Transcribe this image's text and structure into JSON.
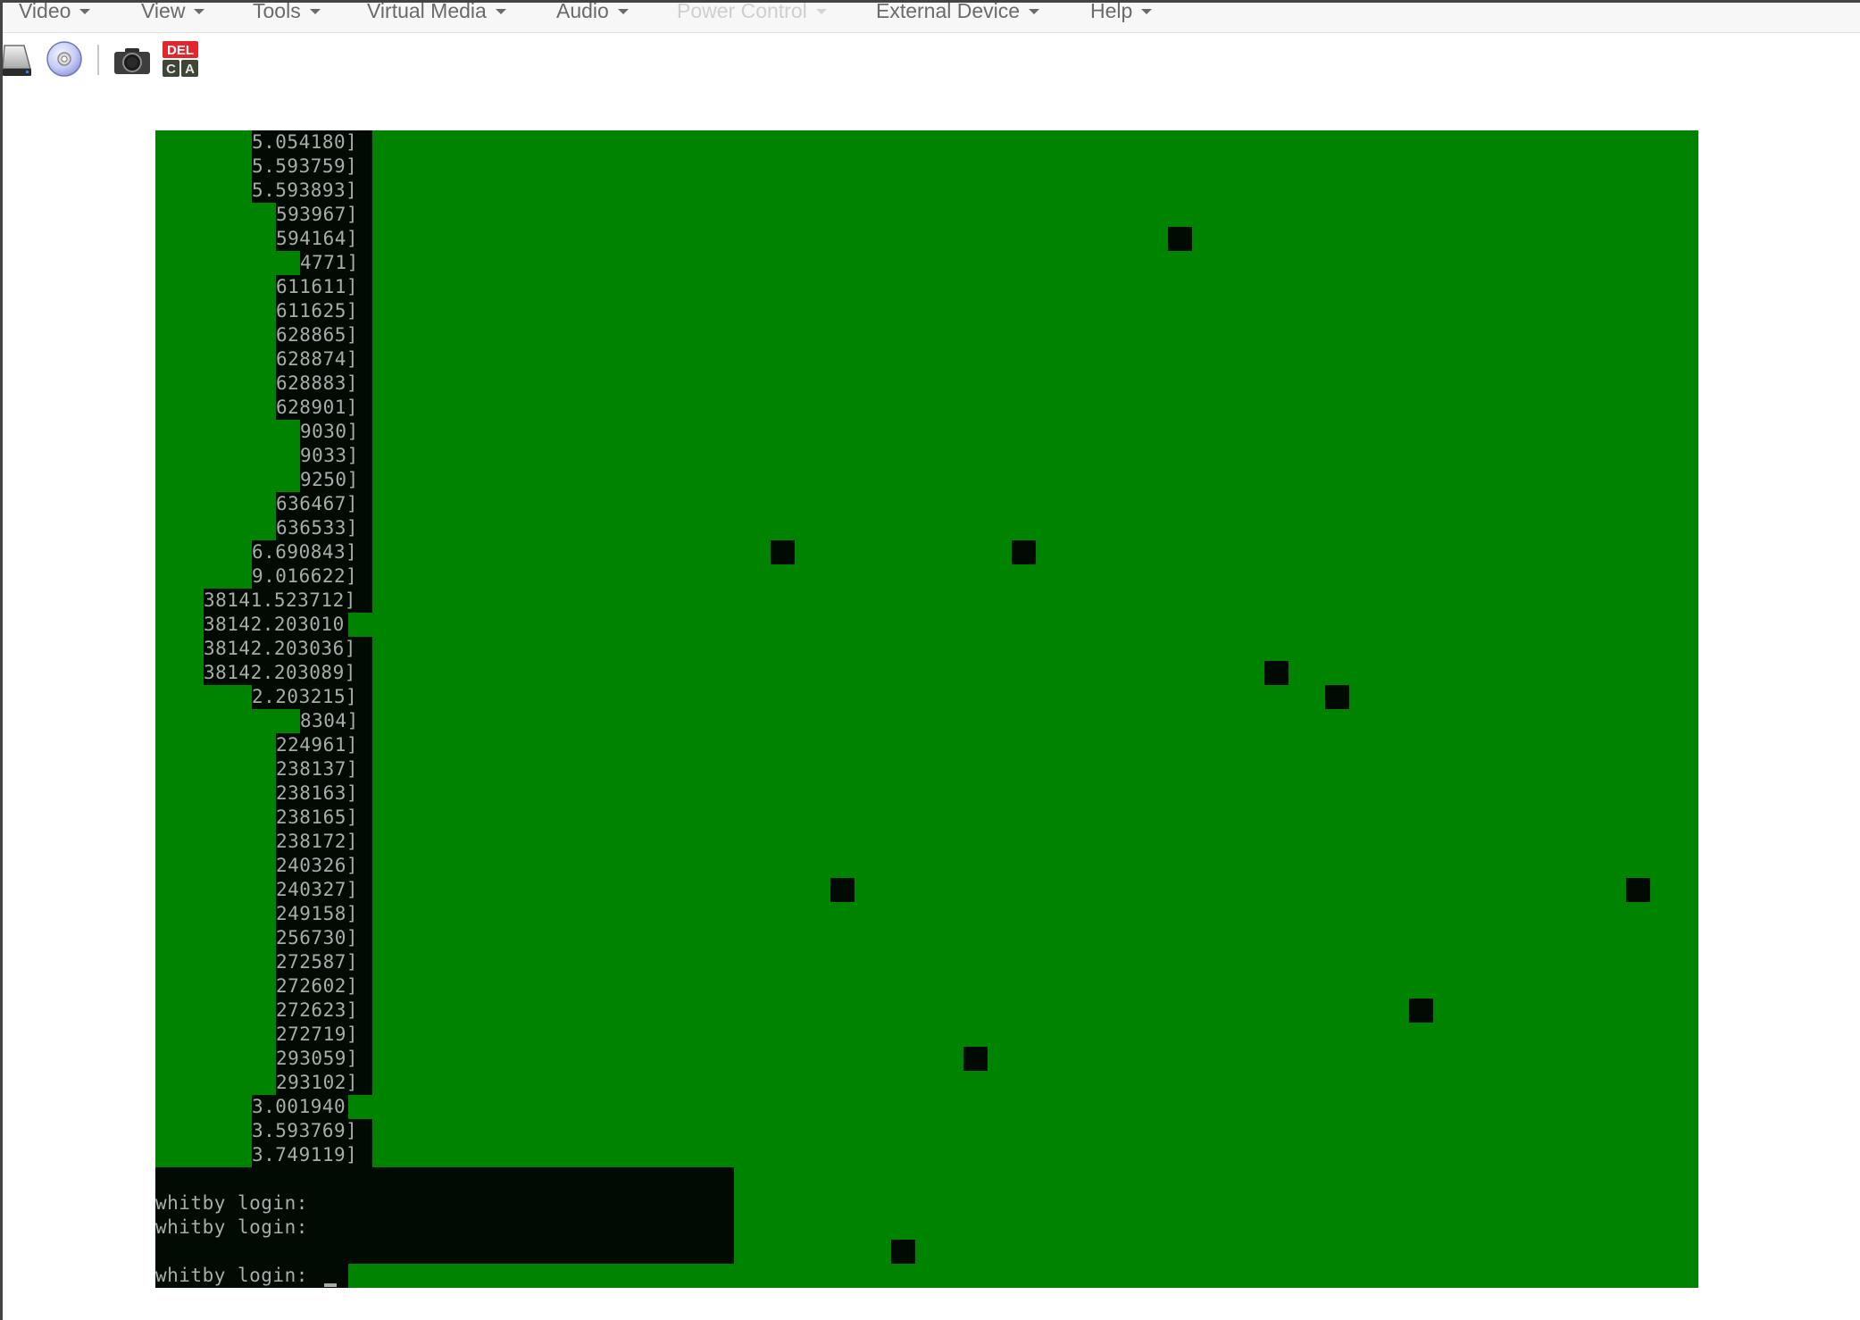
{
  "menubar": {
    "items": [
      {
        "label": "Video",
        "enabled": true
      },
      {
        "label": "View",
        "enabled": true
      },
      {
        "label": "Tools",
        "enabled": true
      },
      {
        "label": "Virtual Media",
        "enabled": true
      },
      {
        "label": "Audio",
        "enabled": true
      },
      {
        "label": "Power Control",
        "enabled": false
      },
      {
        "label": "External Device",
        "enabled": true
      },
      {
        "label": "Help",
        "enabled": true
      }
    ]
  },
  "toolbar": {
    "buttons": [
      {
        "icon": "hard-drive-icon",
        "tooltip": "Hard disk"
      },
      {
        "icon": "cd-rom-icon",
        "tooltip": "CD/DVD"
      },
      {
        "icon": "camera-icon",
        "tooltip": "Screenshot"
      },
      {
        "icon": "ctrl-alt-del-icon",
        "tooltip": "Ctrl+Alt+Del",
        "label_top": "DEL",
        "label_left": "C",
        "label_right": "A"
      }
    ]
  },
  "console": {
    "colors": {
      "background": "#008400",
      "text_bg": "#010a03",
      "text": "#a9aca9"
    },
    "grid": {
      "cols": 128,
      "rows": 48
    },
    "log_lines": [
      {
        "col": 8,
        "text": "5.054180]"
      },
      {
        "col": 8,
        "text": "5.593759]"
      },
      {
        "col": 8,
        "text": "5.593893]"
      },
      {
        "col": 10,
        "text": "593967]"
      },
      {
        "col": 10,
        "text": "594164]"
      },
      {
        "col": 12,
        "text": "4771]"
      },
      {
        "col": 10,
        "text": "611611]"
      },
      {
        "col": 10,
        "text": "611625]"
      },
      {
        "col": 10,
        "text": "628865]"
      },
      {
        "col": 10,
        "text": "628874]"
      },
      {
        "col": 10,
        "text": "628883]"
      },
      {
        "col": 10,
        "text": "628901]"
      },
      {
        "col": 12,
        "text": "9030]"
      },
      {
        "col": 12,
        "text": "9033]"
      },
      {
        "col": 12,
        "text": "9250]"
      },
      {
        "col": 10,
        "text": "636467]"
      },
      {
        "col": 10,
        "text": "636533]"
      },
      {
        "col": 8,
        "text": "6.690843]"
      },
      {
        "col": 8,
        "text": "9.016622]"
      },
      {
        "col": 4,
        "text": "38141.523712]"
      },
      {
        "col": 4,
        "text": "38142.203010"
      },
      {
        "col": 4,
        "text": "38142.203036]"
      },
      {
        "col": 4,
        "text": "38142.203089]"
      },
      {
        "col": 8,
        "text": "2.203215]"
      },
      {
        "col": 12,
        "text": "8304]"
      },
      {
        "col": 10,
        "text": "224961]"
      },
      {
        "col": 10,
        "text": "238137]"
      },
      {
        "col": 10,
        "text": "238163]"
      },
      {
        "col": 10,
        "text": "238165]"
      },
      {
        "col": 10,
        "text": "238172]"
      },
      {
        "col": 10,
        "text": "240326]"
      },
      {
        "col": 10,
        "text": "240327]"
      },
      {
        "col": 10,
        "text": "249158]"
      },
      {
        "col": 10,
        "text": "256730]"
      },
      {
        "col": 10,
        "text": "272587]"
      },
      {
        "col": 10,
        "text": "272602]"
      },
      {
        "col": 10,
        "text": "272623]"
      },
      {
        "col": 10,
        "text": "272719]"
      },
      {
        "col": 10,
        "text": "293059]"
      },
      {
        "col": 10,
        "text": "293102]"
      },
      {
        "col": 8,
        "text": "3.001940"
      },
      {
        "col": 8,
        "text": "3.593769]"
      },
      {
        "col": 8,
        "text": "3.749119]"
      }
    ],
    "login_lines": [
      {
        "row": 44,
        "text": "whitby login:"
      },
      {
        "row": 45,
        "text": "whitby login:"
      },
      {
        "row": 47,
        "text": "whitby login: "
      }
    ],
    "artifact_squares": [
      {
        "col": 84,
        "row": 4
      },
      {
        "col": 51,
        "row": 17
      },
      {
        "col": 71,
        "row": 17
      },
      {
        "col": 92,
        "row": 22
      },
      {
        "col": 97,
        "row": 23
      },
      {
        "col": 56,
        "row": 31
      },
      {
        "col": 122,
        "row": 31
      },
      {
        "col": 104,
        "row": 36
      },
      {
        "col": 67,
        "row": 38
      },
      {
        "col": 61,
        "row": 46
      }
    ]
  }
}
